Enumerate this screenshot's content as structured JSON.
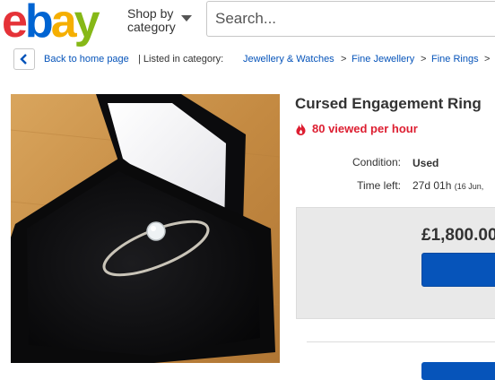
{
  "header": {
    "logo_letters": [
      {
        "char": "e",
        "color": "#e53238"
      },
      {
        "char": "b",
        "color": "#0064d2"
      },
      {
        "char": "a",
        "color": "#f5af02"
      },
      {
        "char": "y",
        "color": "#86b817"
      }
    ],
    "shop_by_line1": "Shop by",
    "shop_by_line2": "category",
    "search_placeholder": "Search..."
  },
  "breadcrumb": {
    "back_label": "Back to home page",
    "listed_label": "| Listed in category:",
    "items": [
      "Jewellery & Watches",
      "Fine Jewellery",
      "Fine Rings"
    ],
    "separator": ">"
  },
  "listing": {
    "title": "Cursed Engagement Ring",
    "viewed": "80 viewed per hour",
    "condition_label": "Condition:",
    "condition_value": "Used",
    "time_left_label": "Time left:",
    "time_left_value": "27d 01h",
    "time_left_detail": "(16 Jun,",
    "price": "£1,800.00"
  },
  "colors": {
    "link": "#0654ba",
    "accent_red": "#dd1e31",
    "button": "#0654ba"
  }
}
